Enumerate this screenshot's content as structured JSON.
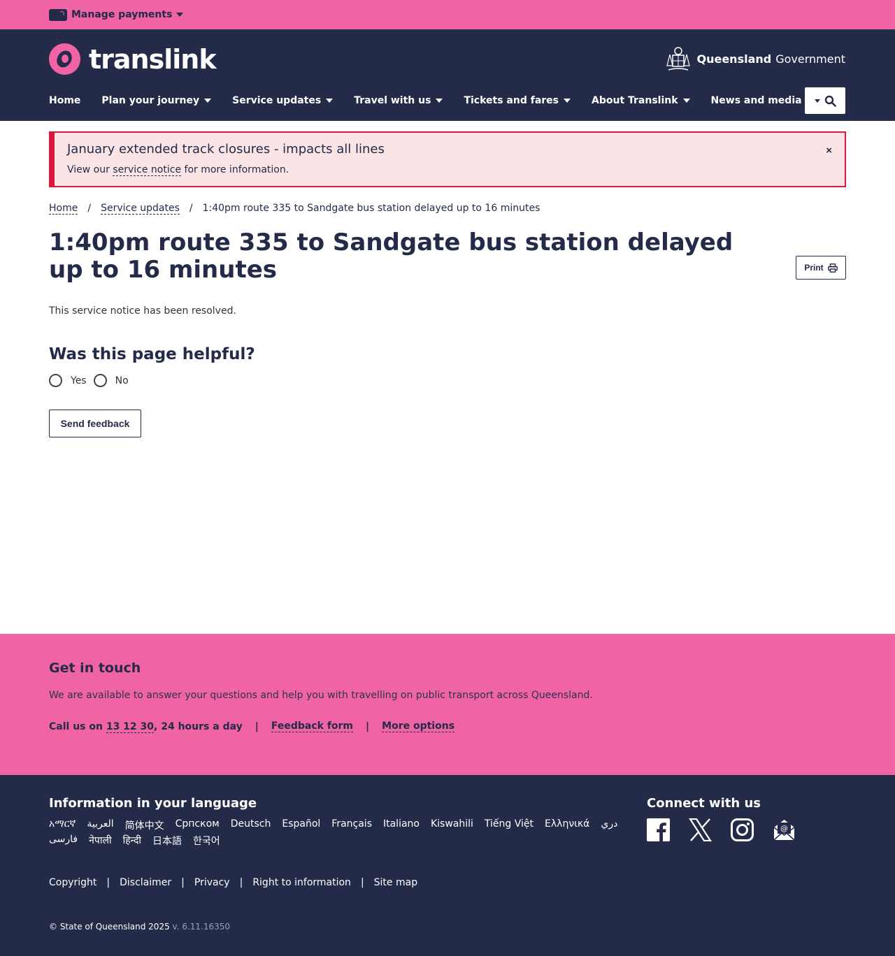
{
  "topbar": {
    "manage_label": "Manage payments"
  },
  "header": {
    "logo_text": "translink",
    "gov_bold": "Queensland",
    "gov_light": "Government",
    "nav": [
      {
        "label": "Home",
        "dropdown": false
      },
      {
        "label": "Plan your journey",
        "dropdown": true
      },
      {
        "label": "Service updates",
        "dropdown": true
      },
      {
        "label": "Travel with us",
        "dropdown": true
      },
      {
        "label": "Tickets and fares",
        "dropdown": true
      },
      {
        "label": "About Translink",
        "dropdown": true
      },
      {
        "label": "News and media",
        "dropdown": true
      }
    ]
  },
  "alert": {
    "title": "January extended track closures - impacts all lines",
    "text_before": "View our ",
    "link": "service notice",
    "text_after": " for more information.",
    "close": "×"
  },
  "breadcrumb": {
    "home": "Home",
    "service_updates": "Service updates",
    "current": "1:40pm route 335 to Sandgate bus station delayed up to 16 minutes",
    "separator": "/"
  },
  "page": {
    "title": "1:40pm route 335 to Sandgate bus station delayed up to 16 minutes",
    "print_label": "Print",
    "resolved_text": "This service notice has been resolved.",
    "helpful_title": "Was this page helpful?",
    "yes": "Yes",
    "no": "No",
    "feedback_btn": "Send feedback"
  },
  "touch": {
    "title": "Get in touch",
    "text": "We are available to answer your questions and help you with travelling on public transport across Queensland.",
    "call_prefix": "Call us on ",
    "call_number": "13 12 30",
    "call_suffix": ", 24 hours a day",
    "feedback_form": "Feedback form",
    "more_options": "More options",
    "separator": "|"
  },
  "footer": {
    "lang_title": "Information in your language",
    "languages": [
      "አማርኛ",
      "العربية",
      "简体中文",
      "Српском",
      "Deutsch",
      "Español",
      "Français",
      "Italiano",
      "Kiswahili",
      "Tiếng Việt",
      "Ελληνικά",
      "دري",
      "فارسی",
      "नेपाली",
      "हिन्दी",
      "日本語",
      "한국어"
    ],
    "connect_title": "Connect with us",
    "legal": [
      "Copyright",
      "Disclaimer",
      "Privacy",
      "Right to information",
      "Site map"
    ],
    "separator": "|",
    "copyright": "© State of Queensland 2025",
    "version": "v. 6.11.16350"
  },
  "colors": {
    "pink": "#f063a4",
    "navy": "#232b48",
    "alert_red": "#d8183d",
    "alert_bg": "#fae4e5"
  }
}
